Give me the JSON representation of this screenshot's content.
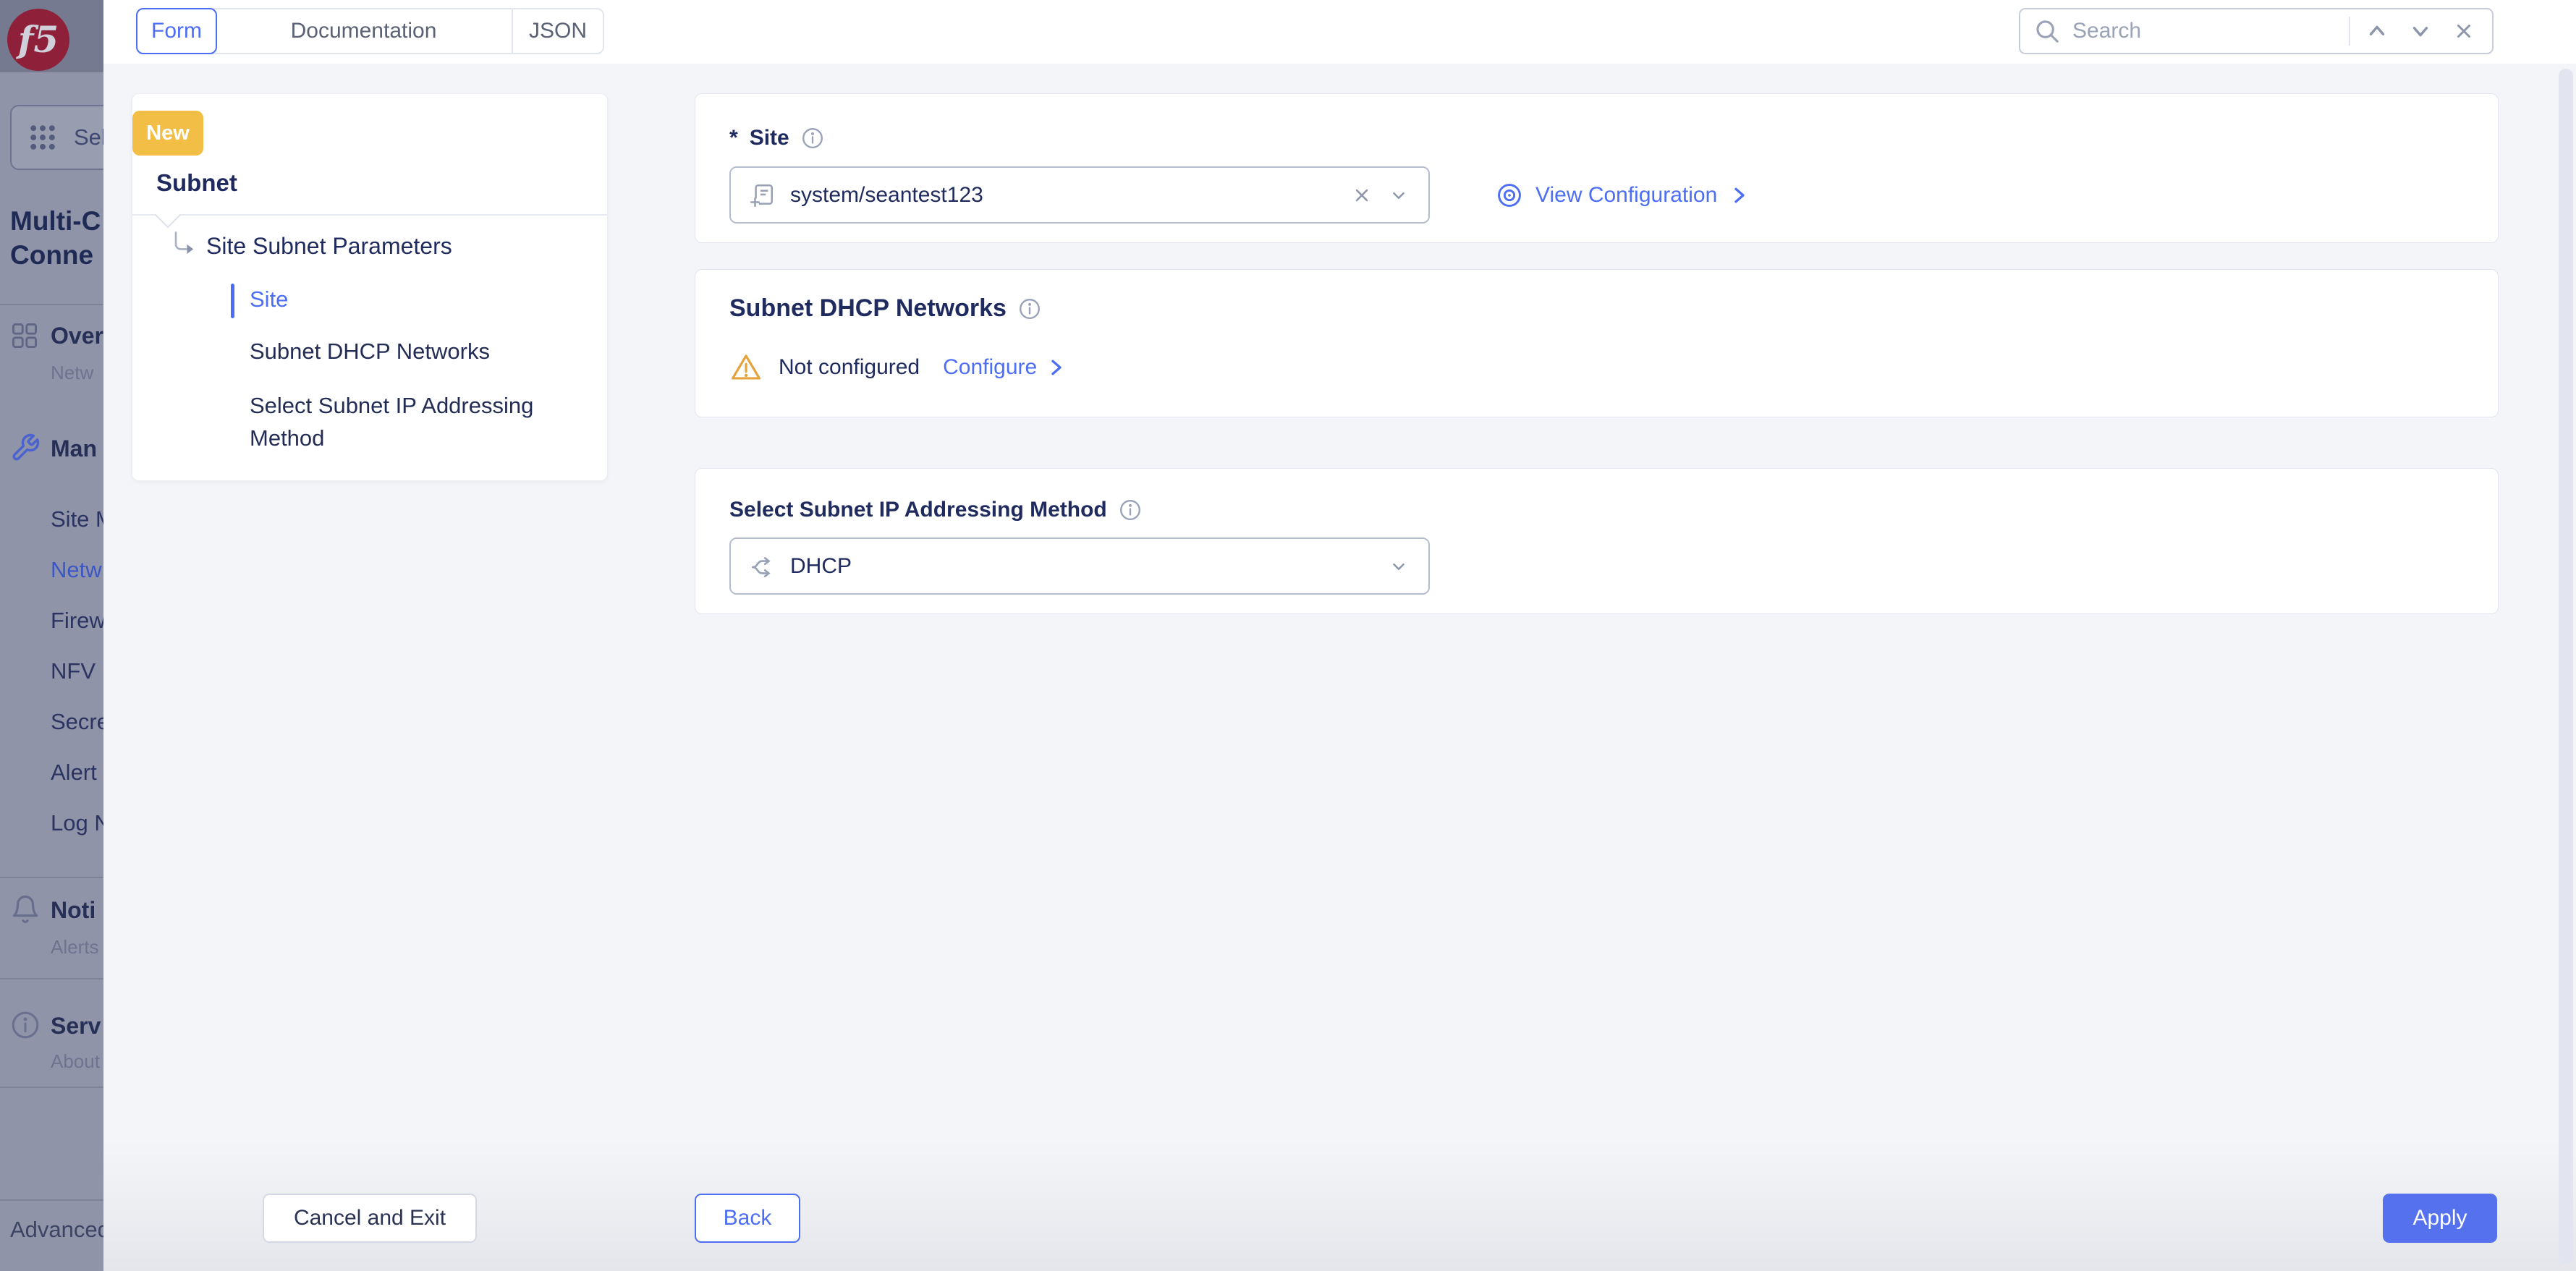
{
  "colors": {
    "accent": "#4C6EF5",
    "apply_button": "#5571EE",
    "badge": "#F2BE45",
    "warning": "#E6A23C",
    "brand_red": "#8E2139",
    "heading": "#1F2A5E",
    "body_bg": "#F4F5F8"
  },
  "underlay": {
    "logo": "f5",
    "select_service": "Sele",
    "title_line1": "Multi-C",
    "title_line2": "Conne",
    "nav": {
      "overview": {
        "label": "Over",
        "sub": "Netw"
      },
      "manage": {
        "label": "Man"
      },
      "manage_items": [
        "Site M",
        "Netw",
        "Firew",
        "NFV",
        "Secre",
        "Alert",
        "Log N"
      ],
      "notifications": {
        "label": "Noti",
        "sub": "Alerts"
      },
      "service": {
        "label": "Serv",
        "sub": "About"
      },
      "advanced": "Advanced"
    }
  },
  "topbar": {
    "tabs": [
      {
        "label": "Form",
        "active": true
      },
      {
        "label": "Documentation",
        "active": false
      },
      {
        "label": "JSON",
        "active": false
      }
    ],
    "search": {
      "placeholder": "Search",
      "value": ""
    }
  },
  "panel": {
    "badge": "New",
    "title": "Subnet",
    "tree": {
      "root": "Site Subnet Parameters",
      "items": [
        {
          "label": "Site",
          "active": true
        },
        {
          "label": "Subnet DHCP Networks",
          "active": false
        },
        {
          "label": "Select Subnet IP Addressing Method",
          "active": false
        }
      ]
    }
  },
  "form": {
    "site": {
      "required_mark": "*",
      "label": "Site",
      "value": "system/seantest123",
      "view_link": "View Configuration"
    },
    "dhcp_networks": {
      "title": "Subnet DHCP Networks",
      "status": "Not configured",
      "action": "Configure"
    },
    "ip_method": {
      "label": "Select Subnet IP Addressing Method",
      "value": "DHCP"
    }
  },
  "footer": {
    "cancel": "Cancel and Exit",
    "back": "Back",
    "apply": "Apply"
  },
  "icons": {
    "search": "magnifier",
    "chevron_up": "caret-up",
    "chevron_down": "caret-down",
    "close_x": "x-mark",
    "clear_x": "x-mark",
    "select_caret": "caret-down",
    "info": "info-circle",
    "warning": "warning-triangle-exclamation",
    "view": "concentric-eye-target",
    "site_reference": "document-with-plus",
    "ip_method": "branching-arrows-shuffle",
    "apps_grid": "grid-3x3-dots",
    "overview": "grid-2x2-squares",
    "manage": "wrench",
    "notifications": "bell",
    "service_info": "info-circle",
    "tree_arrow": "corner-down-right-arrow",
    "link_chevron": "chevron-right"
  }
}
